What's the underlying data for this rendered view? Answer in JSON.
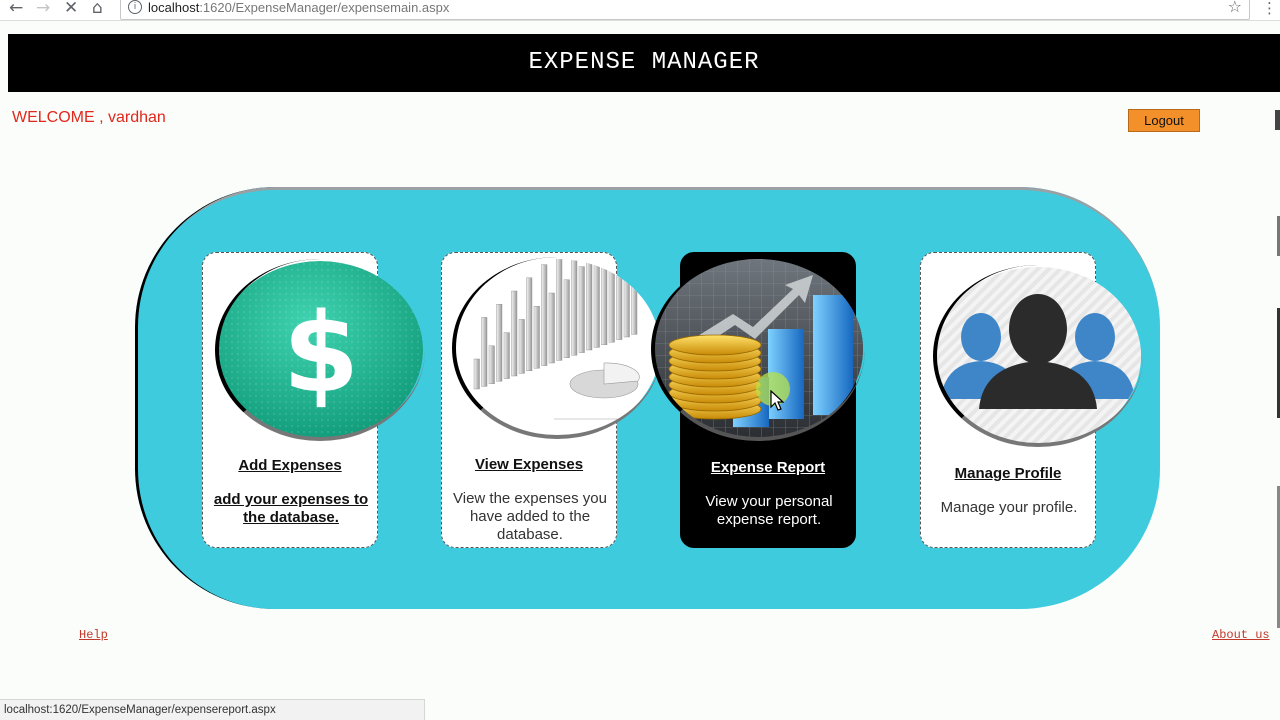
{
  "browser": {
    "url_host": "localhost",
    "url_path": ":1620/ExpenseManager/expensemain.aspx",
    "status_url": "localhost:1620/ExpenseManager/expensereport.aspx"
  },
  "header": {
    "title": "EXPENSE MANAGER"
  },
  "user": {
    "welcome": "WELCOME , vardhan",
    "logout_label": "Logout"
  },
  "cards": [
    {
      "title": "Add Expenses ",
      "desc": "add your expenses to the database.",
      "icon": "dollar-icon"
    },
    {
      "title": "View Expenses",
      "desc": "View the expenses you have added to the database.",
      "icon": "chart-icon"
    },
    {
      "title": "Expense Report",
      "desc": "View your personal expense report.",
      "icon": "report-icon"
    },
    {
      "title": "Manage Profile",
      "desc": "Manage your profile.",
      "icon": "users-icon"
    }
  ],
  "footer": {
    "help": "Help",
    "about": "About us"
  },
  "colors": {
    "panel": "#3fcbde",
    "banner": "#000000",
    "welcome": "#e0281c",
    "logout": "#f3902a"
  }
}
